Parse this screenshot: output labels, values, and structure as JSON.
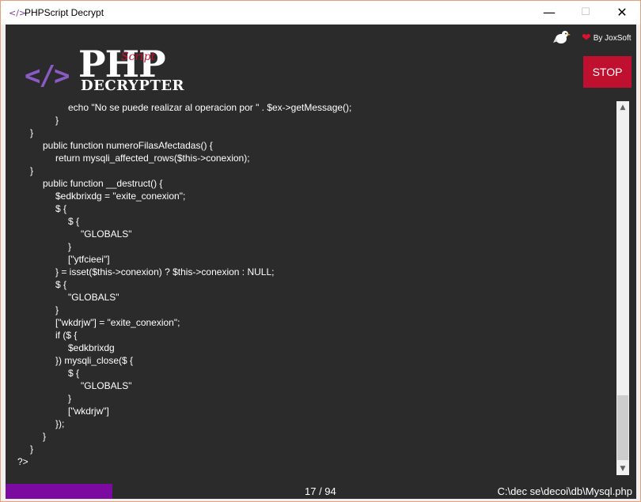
{
  "window": {
    "title": "PHPScript Decrypt",
    "app_icon_glyph": "</>",
    "minimize_glyph": "—",
    "maximize_glyph": "☐",
    "close_glyph": "✕"
  },
  "header": {
    "credit": "By JoxSoft",
    "heart_glyph": "❤",
    "logo": {
      "glyph": "</>",
      "title": "PHP",
      "script": "Script",
      "subtitle": "DECRYPTER"
    },
    "stop_label": "STOP"
  },
  "code_lines": [
    {
      "indent": 4,
      "text": "echo \"No se puede realizar al operacion por \" . $ex->getMessage();"
    },
    {
      "indent": 3,
      "text": "}"
    },
    {
      "indent": 1,
      "text": "}"
    },
    {
      "indent": 2,
      "text": "public function numeroFilasAfectadas() {"
    },
    {
      "indent": 3,
      "text": "return mysqli_affected_rows($this->conexion);"
    },
    {
      "indent": 1,
      "text": "}"
    },
    {
      "indent": 2,
      "text": "public function __destruct() {"
    },
    {
      "indent": 3,
      "text": "$edkbrixdg = \"exite_conexion\";"
    },
    {
      "indent": 3,
      "text": "$ {"
    },
    {
      "indent": 4,
      "text": "$ {"
    },
    {
      "indent": 5,
      "text": "\"GLOBALS\""
    },
    {
      "indent": 4,
      "text": "}"
    },
    {
      "indent": 4,
      "text": "[\"ytfcieei\"]"
    },
    {
      "indent": 3,
      "text": "} = isset($this->conexion) ? $this->conexion : NULL;"
    },
    {
      "indent": 3,
      "text": "$ {"
    },
    {
      "indent": 4,
      "text": "\"GLOBALS\""
    },
    {
      "indent": 3,
      "text": "}"
    },
    {
      "indent": 3,
      "text": "[\"wkdrjw\"] = \"exite_conexion\";"
    },
    {
      "indent": 3,
      "text": "if ($ {"
    },
    {
      "indent": 4,
      "text": "$edkbrixdg"
    },
    {
      "indent": 3,
      "text": "}) mysqli_close($ {"
    },
    {
      "indent": 4,
      "text": "$ {"
    },
    {
      "indent": 5,
      "text": "\"GLOBALS\""
    },
    {
      "indent": 4,
      "text": "}"
    },
    {
      "indent": 4,
      "text": "[\"wkdrjw\"]"
    },
    {
      "indent": 3,
      "text": "});"
    },
    {
      "indent": 2,
      "text": "}"
    },
    {
      "indent": 1,
      "text": "}"
    },
    {
      "indent": 0,
      "text": "?>"
    }
  ],
  "scrollbar": {
    "up_glyph": "▲",
    "down_glyph": "▼"
  },
  "status": {
    "progress": 0.18,
    "page_counter": "17 / 94",
    "file_path": "C:\\dec se\\decoi\\db\\Mysql.php"
  }
}
